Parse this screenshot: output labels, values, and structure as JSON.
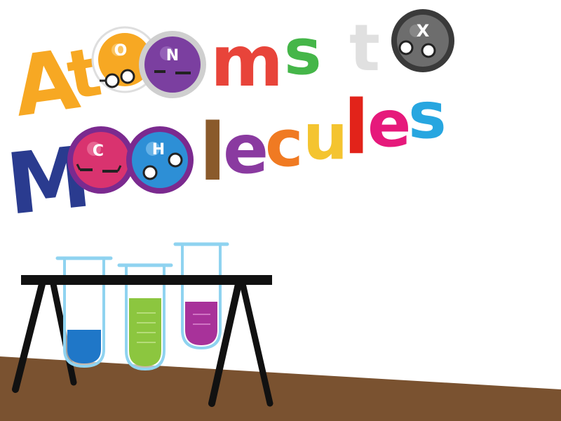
{
  "title": {
    "line1": {
      "letters": [
        "A",
        "t",
        "m",
        "s",
        "t"
      ],
      "colors": [
        "#f7a823",
        "#f7a823",
        "#e8443a",
        "#45b649",
        "#e0e0e0"
      ]
    },
    "line2": {
      "letters": [
        "M",
        "l",
        "e",
        "c",
        "u",
        "l",
        "e",
        "s"
      ],
      "colors": [
        "#2a3b8f",
        "#8a5a2b",
        "#8a3aa0",
        "#f07a22",
        "#f4c430",
        "#e2231a",
        "#e6197b",
        "#27a6e0"
      ]
    }
  },
  "atoms": [
    {
      "label": "O",
      "color": "#f7a823",
      "ring": "#ffffff"
    },
    {
      "label": "N",
      "color": "#7b3fa0",
      "ring": "#cfcfcf"
    },
    {
      "label": "X",
      "color": "#6d6d6d",
      "ring": "#3a3a3a"
    },
    {
      "label": "C",
      "color": "#d9336f",
      "ring": "#7b2a8f"
    },
    {
      "label": "H",
      "color": "#2d8fd6",
      "ring": "#7b2a8f"
    }
  ],
  "lab": {
    "ground_color": "#7a5230",
    "rack_color": "#111111",
    "tubes": [
      {
        "name": "blue",
        "liquid_color": "#1f77c8",
        "fill_fraction": 0.35
      },
      {
        "name": "green",
        "liquid_color": "#8cc63f",
        "fill_fraction": 0.65
      },
      {
        "name": "purple",
        "liquid_color": "#a8329a",
        "fill_fraction": 0.45
      }
    ]
  }
}
